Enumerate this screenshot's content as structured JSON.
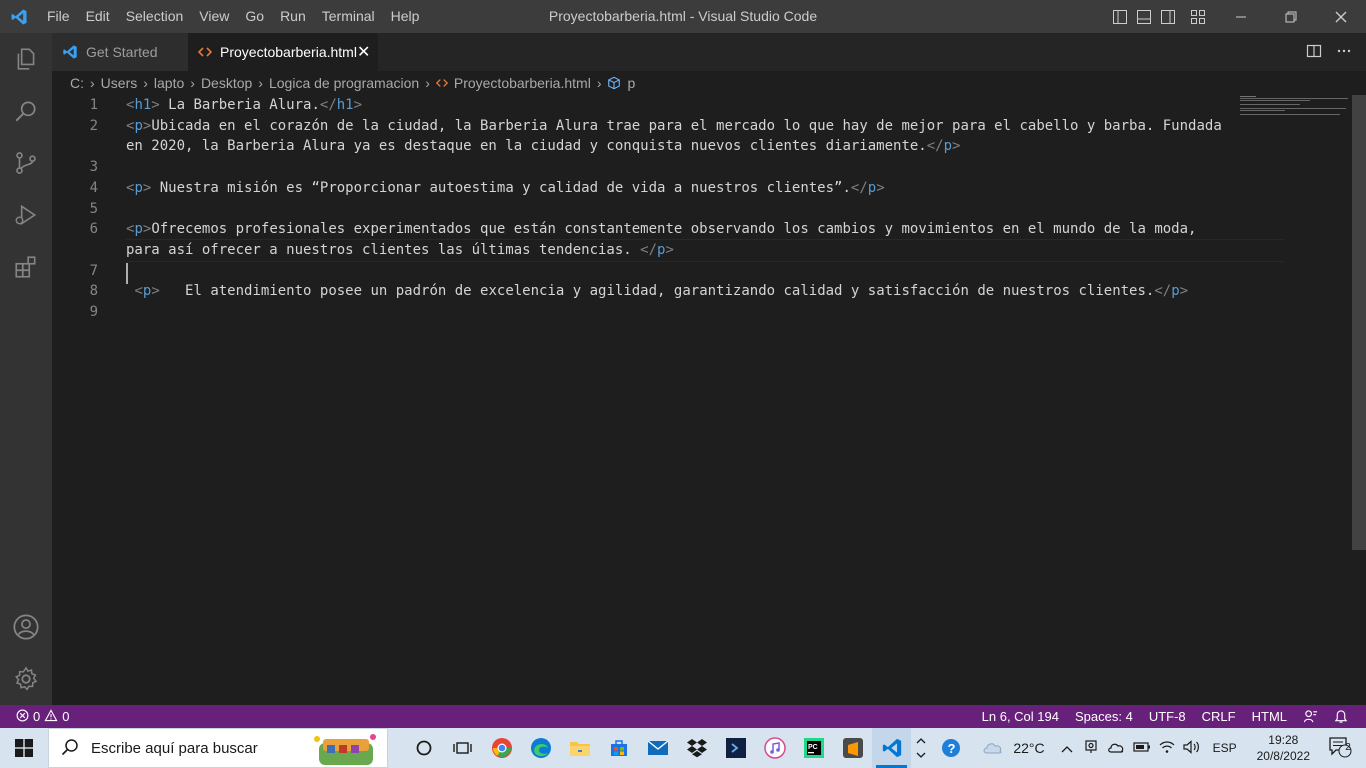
{
  "window": {
    "title": "Proyectobarberia.html - Visual Studio Code",
    "menu": [
      "File",
      "Edit",
      "Selection",
      "View",
      "Go",
      "Run",
      "Terminal",
      "Help"
    ]
  },
  "tabs": [
    {
      "label": "Get Started",
      "icon": "vscode-icon",
      "active": false
    },
    {
      "label": "Proyectobarberia.html",
      "icon": "html-file-icon",
      "active": true,
      "close": "✕"
    }
  ],
  "breadcrumb": {
    "items": [
      "C:",
      "Users",
      "lapto",
      "Desktop",
      "Logica de programacion",
      "Proyectobarberia.html",
      "p"
    ]
  },
  "editor": {
    "lines": [
      {
        "n": "1",
        "parts": [
          [
            "tag",
            "<"
          ],
          [
            "tagname",
            "h1"
          ],
          [
            "tag",
            ">"
          ],
          [
            "text",
            " La Barberia Alura."
          ],
          [
            "tag",
            "</"
          ],
          [
            "tagname",
            "h1"
          ],
          [
            "tag",
            ">"
          ]
        ]
      },
      {
        "n": "2",
        "parts": [
          [
            "tag",
            "<"
          ],
          [
            "tagname",
            "p"
          ],
          [
            "tag",
            ">"
          ],
          [
            "text",
            "Ubicada en el corazón de la ciudad, la Barberia Alura trae para el mercado lo que hay de mejor para el cabello y barba. Fundada"
          ]
        ]
      },
      {
        "n": "",
        "parts": [
          [
            "text",
            "en 2020, la Barberia Alura ya es destaque en la ciudad y conquista nuevos clientes diariamente."
          ],
          [
            "tag",
            "</"
          ],
          [
            "tagname",
            "p"
          ],
          [
            "tag",
            ">"
          ]
        ]
      },
      {
        "n": "3",
        "parts": []
      },
      {
        "n": "4",
        "parts": [
          [
            "tag",
            "<"
          ],
          [
            "tagname",
            "p"
          ],
          [
            "tag",
            ">"
          ],
          [
            "text",
            " Nuestra misión es “Proporcionar autoestima y calidad de vida a nuestros clientes”."
          ],
          [
            "tag",
            "</"
          ],
          [
            "tagname",
            "p"
          ],
          [
            "tag",
            ">"
          ]
        ]
      },
      {
        "n": "5",
        "parts": []
      },
      {
        "n": "6",
        "parts": [
          [
            "tag",
            "<"
          ],
          [
            "tagname",
            "p"
          ],
          [
            "tag",
            ">"
          ],
          [
            "text",
            "Ofrecemos profesionales experimentados que están constantemente observando los cambios y movimientos en el mundo de la moda,"
          ]
        ]
      },
      {
        "n": "",
        "parts": [
          [
            "text",
            "para así ofrecer a nuestros clientes las últimas tendencias. "
          ],
          [
            "tag",
            "</"
          ],
          [
            "tagname",
            "p"
          ],
          [
            "tag",
            ">"
          ]
        ]
      },
      {
        "n": "7",
        "parts": []
      },
      {
        "n": "8",
        "parts": [
          [
            "text",
            " "
          ],
          [
            "tag",
            "<"
          ],
          [
            "tagname",
            "p"
          ],
          [
            "tag",
            ">"
          ],
          [
            "text",
            "   El atendimiento posee un padrón de excelencia y agilidad, garantizando calidad y satisfacción de nuestros clientes."
          ],
          [
            "tag",
            "</"
          ],
          [
            "tagname",
            "p"
          ],
          [
            "tag",
            ">"
          ]
        ]
      },
      {
        "n": "9",
        "parts": []
      }
    ]
  },
  "statusbar": {
    "errors": "0",
    "warnings": "0",
    "position": "Ln 6, Col 194",
    "spaces": "Spaces: 4",
    "encoding": "UTF-8",
    "eol": "CRLF",
    "language": "HTML"
  },
  "taskbar": {
    "search_placeholder": "Escribe aquí para buscar",
    "weather": "22°C",
    "language": "ESP",
    "time": "19:28",
    "date": "20/8/2022",
    "notifications": "2"
  },
  "colors": {
    "statusbar": "#68217a",
    "accent": "#0078d4",
    "tag_blue": "#569cd6"
  }
}
